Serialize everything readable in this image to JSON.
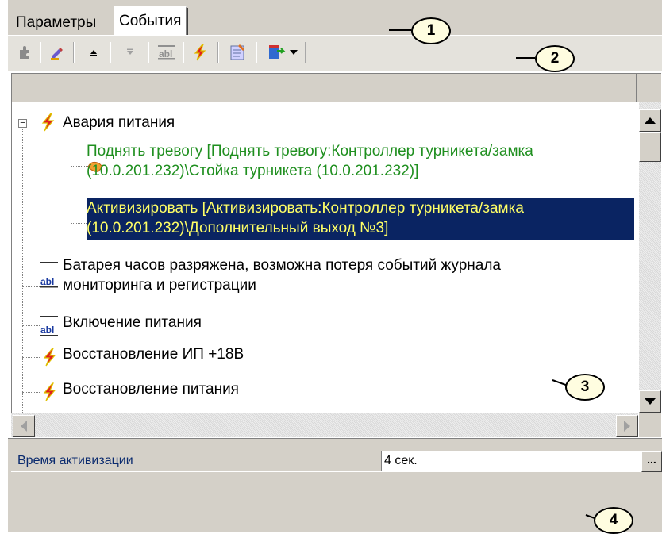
{
  "tabs": [
    {
      "label": "Параметры",
      "active": false
    },
    {
      "label": "События",
      "active": true
    }
  ],
  "toolbar": {
    "icons": [
      "puzzle-icon",
      "edit-pen-icon",
      "move-up-icon",
      "move-down-icon",
      "text-field-icon",
      "lightning-icon",
      "checklist-icon",
      "export-icon",
      "dropdown-arrow-icon"
    ]
  },
  "tree": {
    "nodes": [
      {
        "label": "Авария питания",
        "icon": "lightning-icon"
      },
      {
        "line1": "Поднять тревогу [Поднять тревогу:Контроллер турникета/замка",
        "line2": "(10.0.201.232)\\Стойка турникета (10.0.201.232)]",
        "icon": "alarm-hand-icon",
        "color": "#1f8f1f"
      },
      {
        "line1": "Активизировать [Активизировать:Контроллер турникета/замка",
        "line2": "(10.0.201.232)\\Дополнительный выход №3]",
        "icon": "activate-hand-icon",
        "selected": true
      },
      {
        "line1": "Батарея часов разряжена, возможна потеря событий журнала",
        "line2": "мониторинга и регистрации",
        "icon": "text-field-icon"
      },
      {
        "label": "Включение питания",
        "icon": "text-field-icon"
      },
      {
        "label": "Восстановление ИП +18В",
        "icon": "lightning-icon"
      },
      {
        "label": "Восстановление питания",
        "icon": "lightning-icon"
      }
    ]
  },
  "properties": {
    "name": "Время активизации",
    "value": "4 сек.",
    "ellipsis": "..."
  },
  "callouts": [
    "1",
    "2",
    "3",
    "4"
  ],
  "colors": {
    "selection": "#0a2462",
    "selection_text": "#ffff66",
    "green_text": "#1f8f1f",
    "panel": "#d4d0c8"
  }
}
